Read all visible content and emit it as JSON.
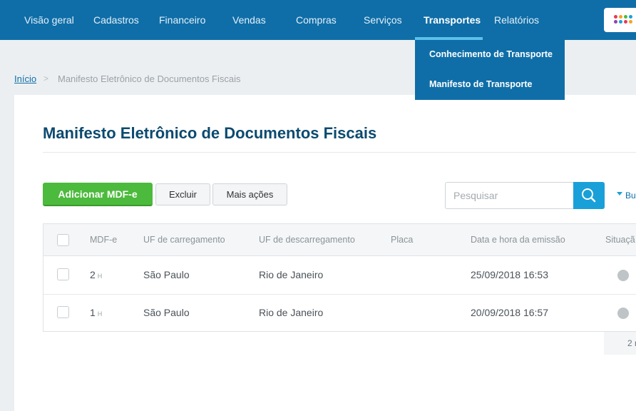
{
  "nav": {
    "items": [
      "Visão geral",
      "Cadastros",
      "Financeiro",
      "Vendas",
      "Compras",
      "Serviços",
      "Transportes",
      "Relatórios"
    ],
    "active": "Transportes"
  },
  "dropdown": {
    "items": [
      "Conhecimento de Transporte",
      "Manifesto de Transporte"
    ]
  },
  "breadcrumb": {
    "home": "Início",
    "separator": ">",
    "current": "Manifesto Eletrônico de Documentos Fiscais"
  },
  "page": {
    "title": "Manifesto Eletrônico de Documentos Fiscais"
  },
  "toolbar": {
    "add_label": "Adicionar MDF-e",
    "delete_label": "Excluir",
    "more_label": "Mais ações",
    "search_placeholder": "Pesquisar",
    "advanced_search": "Bu"
  },
  "table": {
    "columns": [
      "MDF-e",
      "UF de carregamento",
      "UF de descarregamento",
      "Placa",
      "Data e hora da emissão",
      "Situaçã"
    ],
    "rows": [
      {
        "number": "2",
        "flag": "H",
        "uf_load": "São Paulo",
        "uf_unload": "Rio de Janeiro",
        "plate": "",
        "datetime": "25/09/2018 16:53"
      },
      {
        "number": "1",
        "flag": "H",
        "uf_load": "São Paulo",
        "uf_unload": "Rio de Janeiro",
        "plate": "",
        "datetime": "20/09/2018 16:57"
      }
    ]
  },
  "pagination": {
    "text": "2 r"
  },
  "colors": {
    "nav_bg": "#0f6ea8",
    "accent": "#1aa0d8",
    "primary_button": "#4cba3c",
    "title": "#0c4a6f",
    "status_gray": "#bfc4c7"
  },
  "icons": {
    "search": "search-icon",
    "apps": "apps-grid-icon",
    "caret": "caret-down-icon"
  }
}
